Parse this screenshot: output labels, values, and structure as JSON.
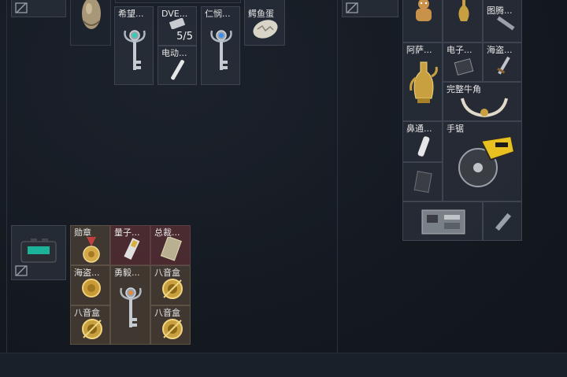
{
  "left_container": {
    "items": [
      {
        "label": "希望..."
      },
      {
        "label": "DVE...",
        "count": "5/5"
      },
      {
        "label": "仁悯..."
      },
      {
        "label": "鳄鱼蛋"
      },
      {
        "label": "电动..."
      }
    ]
  },
  "bottom_case": {
    "items": [
      {
        "label": "勋章"
      },
      {
        "label": "量子..."
      },
      {
        "label": "总裁..."
      },
      {
        "label": "海盗..."
      },
      {
        "label": "勇毅..."
      },
      {
        "label": "八音盒"
      },
      {
        "label": "八音盒"
      },
      {
        "label": "八音盒"
      }
    ]
  },
  "right_container": {
    "items": [
      {
        "label": "图腾..."
      },
      {
        "label": "阿萨..."
      },
      {
        "label": "电子..."
      },
      {
        "label": "海盗..."
      },
      {
        "label": "完整牛角"
      },
      {
        "label": "鼻通..."
      },
      {
        "label": "手锯"
      }
    ]
  },
  "colors": {
    "background": "#151a22",
    "slot_red": "#5c3034",
    "slot_tan": "#4e4236",
    "slot_default": "#282e38"
  }
}
